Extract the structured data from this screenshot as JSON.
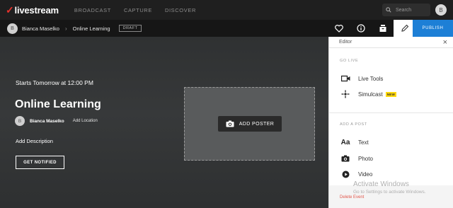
{
  "topnav": {
    "logo_text": "livestream",
    "links": [
      "BROADCAST",
      "CAPTURE",
      "DISCOVER"
    ],
    "search_placeholder": "Search",
    "user_initial": "B"
  },
  "subnav": {
    "user_initial": "B",
    "owner": "Bianca Maselko",
    "event": "Online Learning",
    "status": "DRAFT",
    "publish_label": "PUBLISH"
  },
  "event": {
    "starts": "Starts Tomorrow at 12:00 PM",
    "title": "Online Learning",
    "owner_initial": "B",
    "owner": "Bianca Maselko",
    "add_location": "Add Location",
    "add_description": "Add Description",
    "notify_label": "GET NOTIFIED",
    "add_poster_label": "ADD POSTER"
  },
  "panel": {
    "title": "Editor",
    "go_live_heading": "GO LIVE",
    "live_tools": "Live Tools",
    "simulcast": "Simulcast",
    "new_badge": "NEW",
    "add_post_heading": "ADD A POST",
    "text": "Text",
    "photo": "Photo",
    "video": "Video",
    "delete": "Delete Event"
  },
  "watermark": {
    "title": "Activate Windows",
    "subtitle": "Go to Settings to activate Windows."
  },
  "colors": {
    "brand_red": "#e8322c",
    "publish_blue": "#1d7fd6",
    "new_badge": "#ffd80a",
    "delete_red": "#e2574c"
  }
}
